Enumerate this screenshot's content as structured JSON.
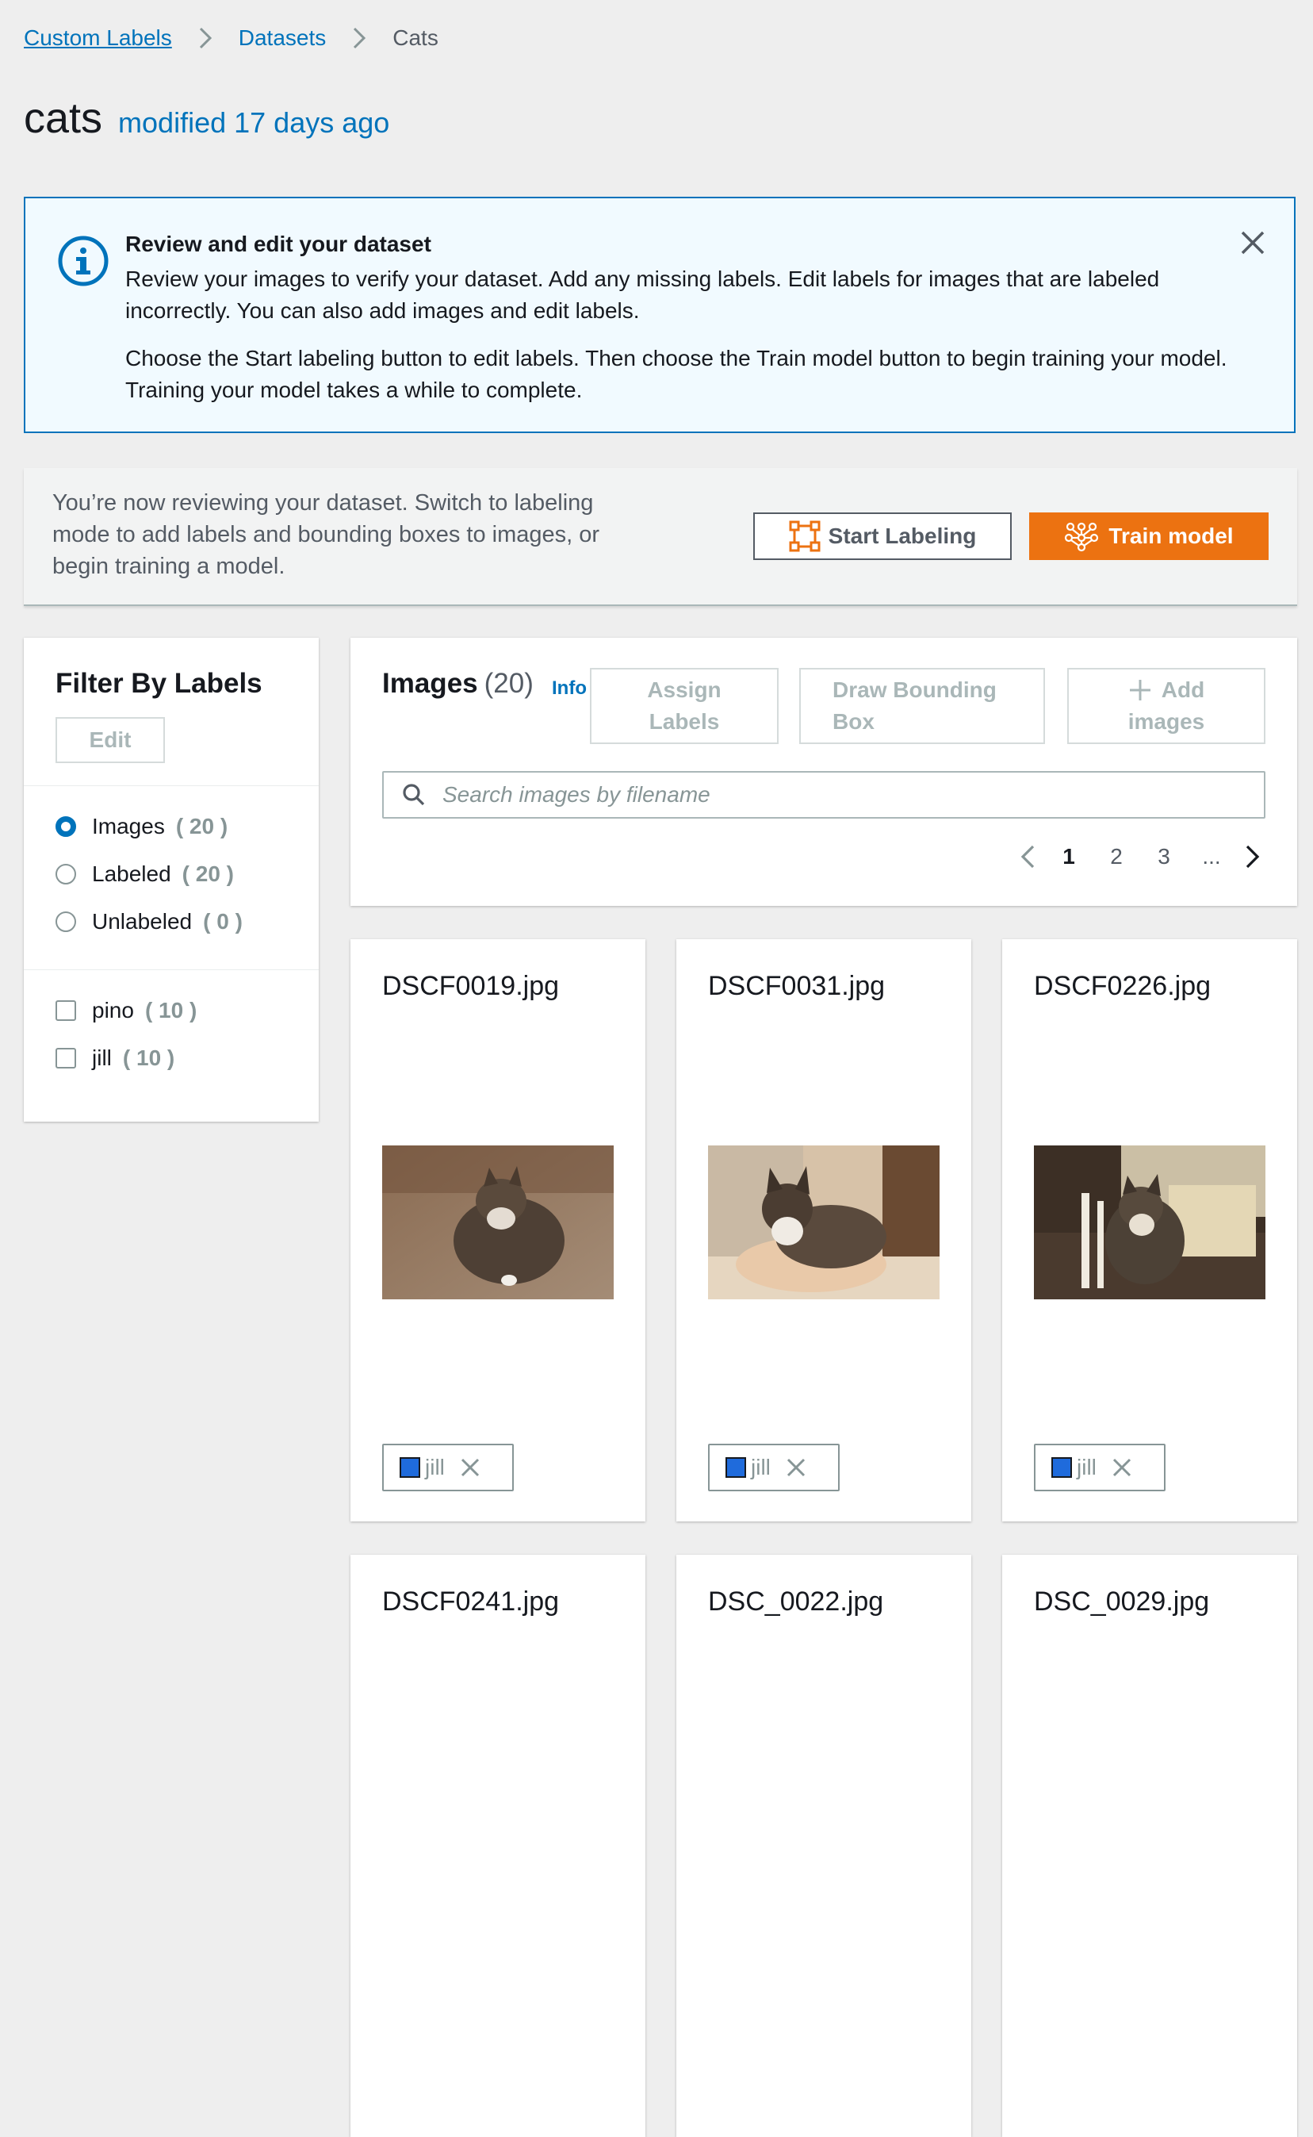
{
  "breadcrumb": {
    "items": [
      "Custom Labels",
      "Datasets",
      "Cats"
    ]
  },
  "header": {
    "title": "cats",
    "modified": "modified 17 days ago"
  },
  "info_box": {
    "title": "Review and edit your dataset",
    "paragraph1": "Review your images to verify your dataset. Add any missing labels. Edit labels for images that are labeled incorrectly. You can also add images and edit labels.",
    "paragraph2": "Choose the Start labeling button to edit labels. Then choose the Train model button to begin training your model. Training your model takes a while to complete."
  },
  "review_bar": {
    "text": "You’re now reviewing your dataset. Switch to labeling mode to add labels and bounding boxes to images, or begin training a model.",
    "start_labeling": "Start Labeling",
    "train_model": "Train model"
  },
  "filter": {
    "title": "Filter By Labels",
    "edit": "Edit",
    "views": [
      {
        "label": "Images",
        "count": "( 20 )",
        "selected": true
      },
      {
        "label": "Labeled",
        "count": "( 20 )",
        "selected": false
      },
      {
        "label": "Unlabeled",
        "count": "( 0 )",
        "selected": false
      }
    ],
    "labels": [
      {
        "label": "pino",
        "count": "( 10 )"
      },
      {
        "label": "jill",
        "count": "( 10 )"
      }
    ]
  },
  "images": {
    "title": "Images",
    "count": "(20)",
    "info": "Info",
    "assign_labels_line1": "Assign",
    "assign_labels_line2": "Labels",
    "draw_box_line1": "Draw Bounding",
    "draw_box_line2": "Box",
    "add_images_line1": "Add",
    "add_images_line2": "images",
    "search_placeholder": "Search images by filename",
    "pages": [
      "1",
      "2",
      "3",
      "..."
    ],
    "current_page": "1"
  },
  "cards": [
    {
      "filename": "DSCF0019.jpg",
      "label": "jill"
    },
    {
      "filename": "DSCF0031.jpg",
      "label": "jill"
    },
    {
      "filename": "DSCF0226.jpg",
      "label": "jill"
    },
    {
      "filename": "DSCF0241.jpg"
    },
    {
      "filename": "DSC_0022.jpg"
    },
    {
      "filename": "DSC_0029.jpg"
    }
  ],
  "colors": {
    "link": "#0073bb",
    "primary_button": "#ec7211",
    "label_swatch": "#1f6bdc",
    "info_border": "#0073bb"
  }
}
